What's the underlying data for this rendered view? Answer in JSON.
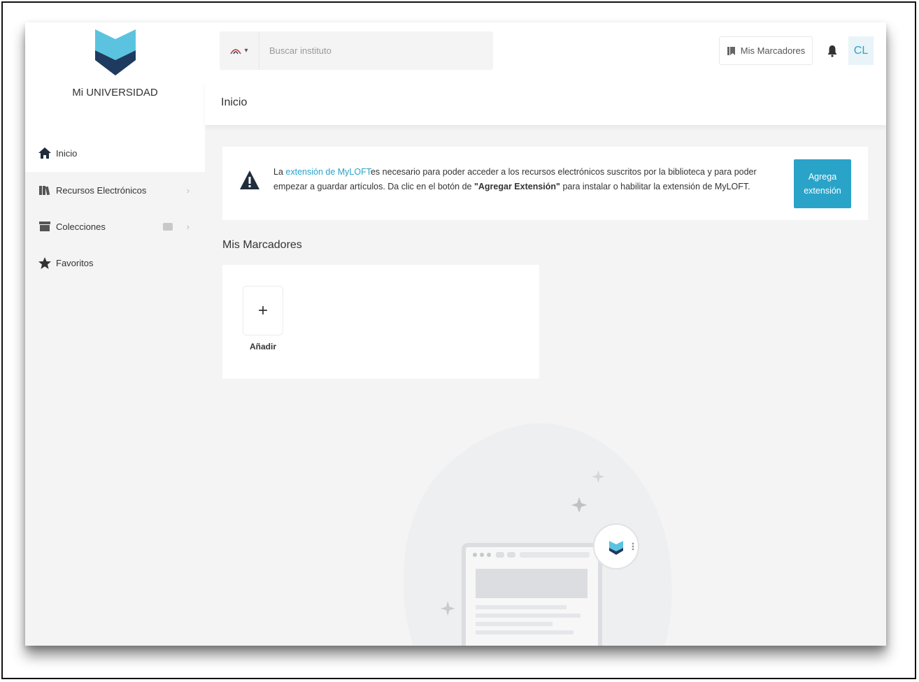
{
  "brand": {
    "name": "Mi UNIVERSIDAD"
  },
  "sidebar": {
    "items": [
      {
        "label": "Inicio",
        "icon": "home-icon",
        "active": true
      },
      {
        "label": "Recursos Electrónicos",
        "icon": "books-icon",
        "chevron": "›"
      },
      {
        "label": "Colecciones",
        "icon": "folder-icon",
        "chevron": "›"
      },
      {
        "label": "Favoritos",
        "icon": "star-icon"
      }
    ]
  },
  "header": {
    "search_placeholder": "Buscar instituto",
    "search_selector_caret": "▾",
    "bookmarks_label": "Mis Marcadores",
    "avatar_initials": "CL"
  },
  "page": {
    "title": "Inicio"
  },
  "alert": {
    "prefix": "La ",
    "link_text": "extensión de MyLOFT",
    "middle": "es necesario para poder acceder a los recursos electrónicos suscritos por la biblioteca y para poder empezar a guardar artículos. Da clic en el botón de ",
    "bold_text": "\"Agregar Extensión\"",
    "suffix": " para instalar o habilitar la extensión de MyLOFT.",
    "button_label": "Agrega extensión"
  },
  "bookmarks": {
    "section_title": "Mis Marcadores",
    "add_symbol": "+",
    "add_label": "Añadir"
  },
  "colors": {
    "accent": "#2aa3c8",
    "logo_light": "#5bc3e0",
    "logo_dark": "#1f3a5f",
    "sidebar_bg": "#f4f4f4"
  }
}
